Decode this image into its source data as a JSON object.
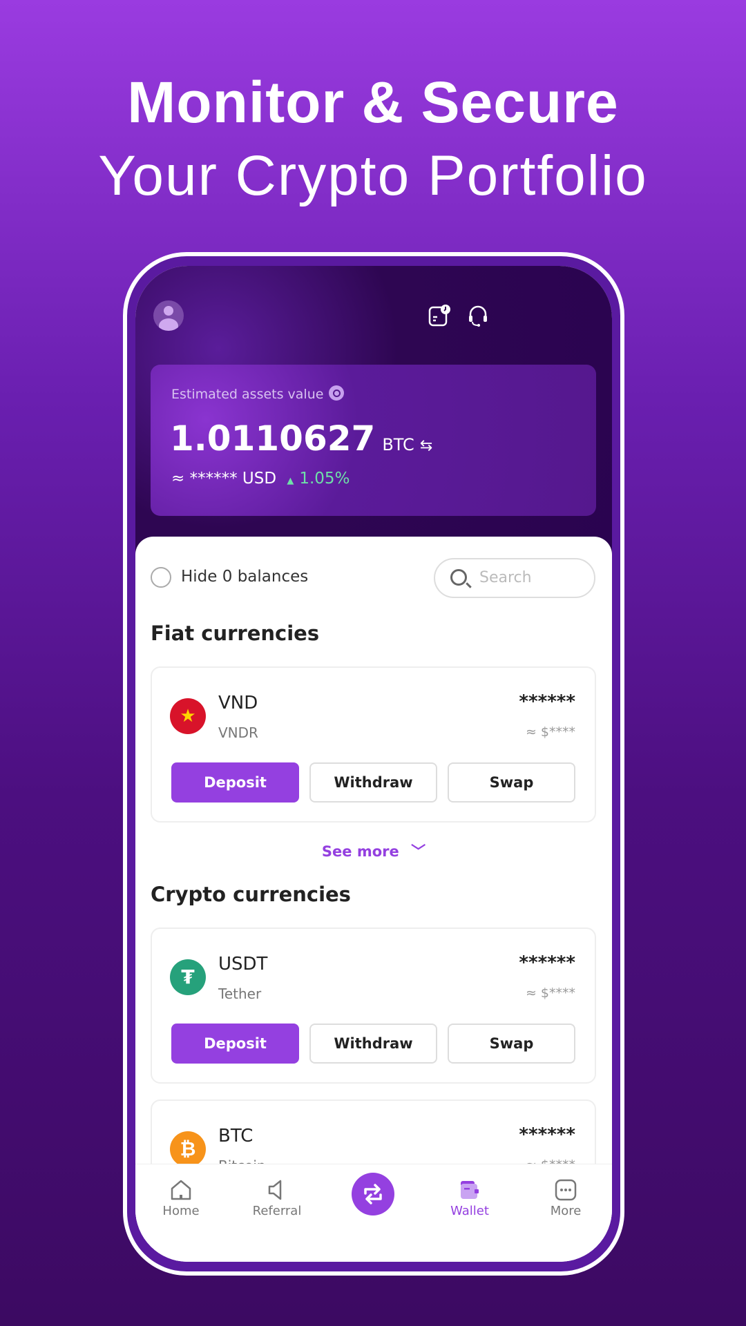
{
  "headline": {
    "line1": "Monitor & Secure",
    "line2": "Your Crypto Portfolio"
  },
  "header": {
    "avatar_icon": "user-avatar-icon",
    "history_icon": "history-icon",
    "support_icon": "headset-icon"
  },
  "assets": {
    "label": "Estimated assets value",
    "value": "1.0110627",
    "unit": "BTC",
    "usd": "≈ ****** USD",
    "change_arrow": "▲",
    "change": "1.05%",
    "change_color": "#6fe0a8"
  },
  "filters": {
    "hide_zero": "Hide 0 balances",
    "hide_zero_checked": false,
    "search_placeholder": "Search"
  },
  "fiat": {
    "title": "Fiat currencies",
    "items": [
      {
        "symbol": "VND",
        "name": "VNDR",
        "balance": "******",
        "fiat": "≈ $****"
      }
    ],
    "see_more": "See more"
  },
  "crypto": {
    "title": "Crypto currencies",
    "items": [
      {
        "symbol": "USDT",
        "name": "Tether",
        "balance": "******",
        "fiat": "≈ $****"
      },
      {
        "symbol": "BTC",
        "name": "Bitcoin",
        "balance": "******",
        "fiat": "≈ $****"
      }
    ]
  },
  "buttons": {
    "deposit": "Deposit",
    "withdraw": "Withdraw",
    "swap": "Swap"
  },
  "nav": {
    "items": [
      {
        "label": "Home"
      },
      {
        "label": "Referral"
      },
      {
        "label": "Wallet",
        "active": true
      },
      {
        "label": "More"
      }
    ],
    "accent": "#9440e0"
  }
}
